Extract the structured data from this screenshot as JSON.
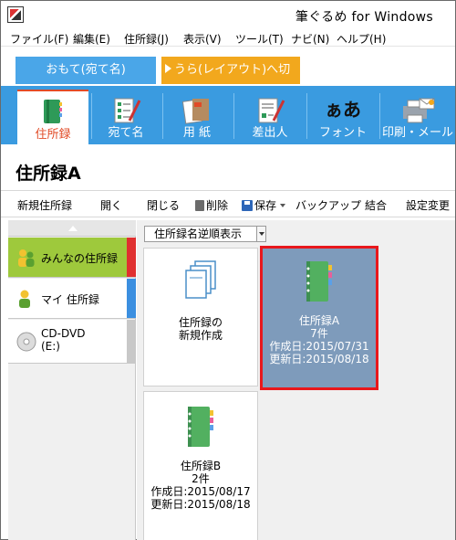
{
  "window": {
    "title": "筆ぐるめ for Windows"
  },
  "menu": [
    "ファイル(F)",
    "編集(E)",
    "住所録(J)",
    "表示(V)",
    "ツール(T)",
    "ナビ(N)",
    "ヘルプ(H)"
  ],
  "tabs": {
    "front": "おもて(宛て名)",
    "back": "うら(レイアウト)へ切替"
  },
  "ribbon": [
    {
      "label": "住所録",
      "icon": "address-book-icon",
      "active": true
    },
    {
      "label": "宛て名",
      "icon": "addressee-icon"
    },
    {
      "label": "用 紙",
      "icon": "paper-icon"
    },
    {
      "label": "差出人",
      "icon": "sender-icon"
    },
    {
      "label": "フォント",
      "icon": "font-icon",
      "glyph": "ぁあ"
    },
    {
      "label": "印刷・メール",
      "icon": "print-mail-icon"
    }
  ],
  "section_title": "住所録A",
  "toolbar": {
    "new": "新規住所録",
    "open": "開く",
    "close": "閉じる",
    "delete": "削除",
    "save": "保存",
    "backup": "バックアップ",
    "merge": "結合",
    "settings": "設定変更"
  },
  "sidebar": {
    "items": [
      {
        "label": "みんなの住所録",
        "active": true,
        "bar_color": "#e03030"
      },
      {
        "label": "マイ 住所録",
        "bar_color": "#3b8fe0"
      },
      {
        "label": "CD-DVD",
        "label2": "(E:)",
        "bar_color": "#c8c8c8"
      }
    ]
  },
  "main": {
    "sort_label": "住所録名逆順表示",
    "cards": [
      {
        "line1": "住所録の",
        "line2": "新規作成",
        "kind": "new"
      },
      {
        "line1": "住所録A",
        "line2": "7件",
        "line3": "作成日:2015/07/31",
        "line4": "更新日:2015/08/18",
        "kind": "book",
        "selected": true
      },
      {
        "line1": "住所録B",
        "line2": "2件",
        "line3": "作成日:2015/08/17",
        "line4": "更新日:2015/08/18",
        "kind": "book"
      }
    ]
  },
  "colors": {
    "ribbon": "#3a9be0",
    "tab_front": "#4aa6e8",
    "tab_back": "#f2a81d",
    "active_red": "#e14b27",
    "selection_border": "#e8181c",
    "selected_card": "#7e9bbb",
    "sidebar_active": "#9ec93c"
  }
}
